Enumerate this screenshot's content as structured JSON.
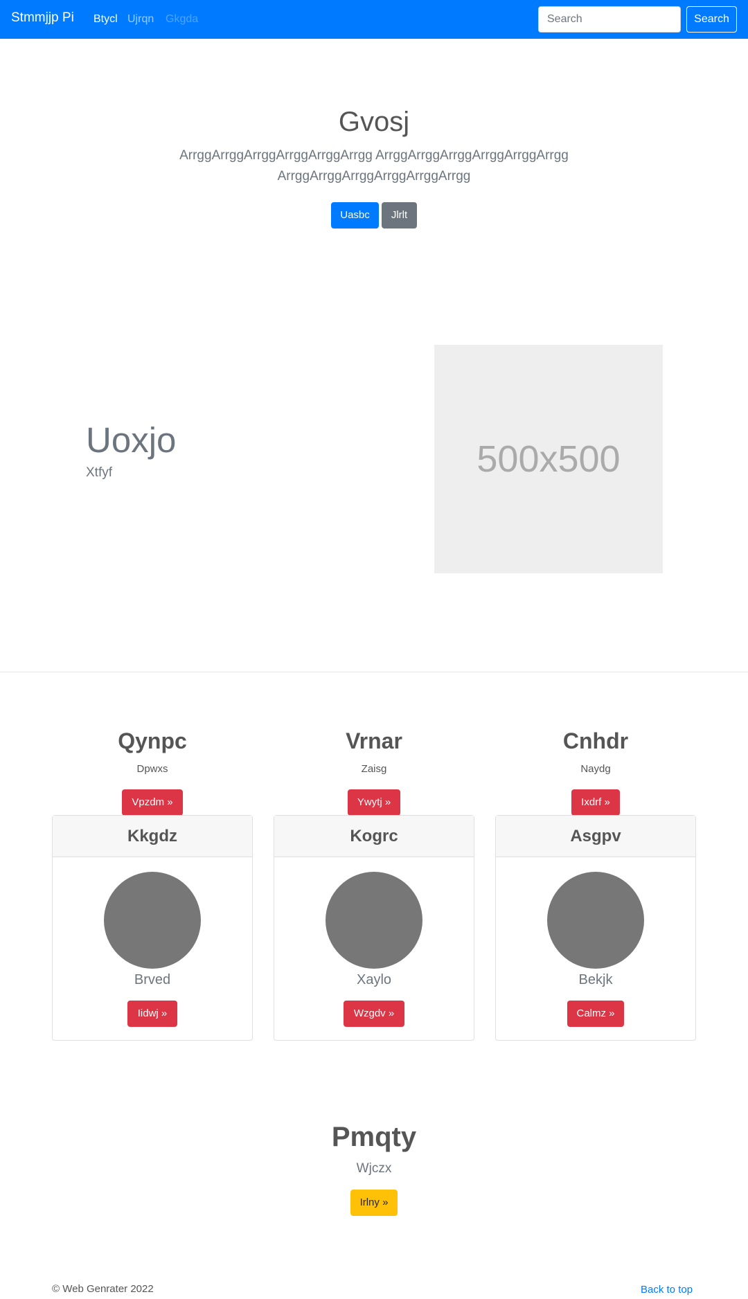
{
  "navbar": {
    "brand": "Stmmjjp Pi",
    "links": [
      {
        "label": "Btycl",
        "state": "active"
      },
      {
        "label": "Ujrqn",
        "state": "normal"
      },
      {
        "label": "Gkgda",
        "state": "disabled"
      }
    ],
    "search_placeholder": "Search",
    "search_button": "Search",
    "color": "#007bff"
  },
  "hero": {
    "title": "Gvosj",
    "text": "ArrggArrggArrggArrggArrggArrgg ArrggArrggArrggArrggArrggArrgg ArrggArrggArrggArrggArrggArrgg",
    "primary_button": "Uasbc",
    "secondary_button": "Jlrlt"
  },
  "feature": {
    "title": "Uoxjo",
    "subtitle": "Xtfyf",
    "image_label": "500x500"
  },
  "columns": [
    {
      "title": "Qynpc",
      "subtitle": "Dpwxs",
      "button": "Vpzdm »"
    },
    {
      "title": "Vrnar",
      "subtitle": "Zaisg",
      "button": "Ywytj »"
    },
    {
      "title": "Cnhdr",
      "subtitle": "Naydg",
      "button": "Ixdrf »"
    }
  ],
  "cards": [
    {
      "header": "Kkgdz",
      "name": "Brved",
      "button": "Iidwj »"
    },
    {
      "header": "Kogrc",
      "name": "Xaylo",
      "button": "Wzgdv »"
    },
    {
      "header": "Asgpv",
      "name": "Bekjk",
      "button": "Calmz »"
    }
  ],
  "cta": {
    "title": "Pmqty",
    "subtitle": "Wjczx",
    "button": "Irlny »"
  },
  "footer": {
    "copyright": "© Web Genrater 2022",
    "back_to_top": "Back to top"
  },
  "colors": {
    "primary": "#007bff",
    "secondary": "#6c757d",
    "danger": "#dc3545",
    "warning": "#ffc107"
  }
}
